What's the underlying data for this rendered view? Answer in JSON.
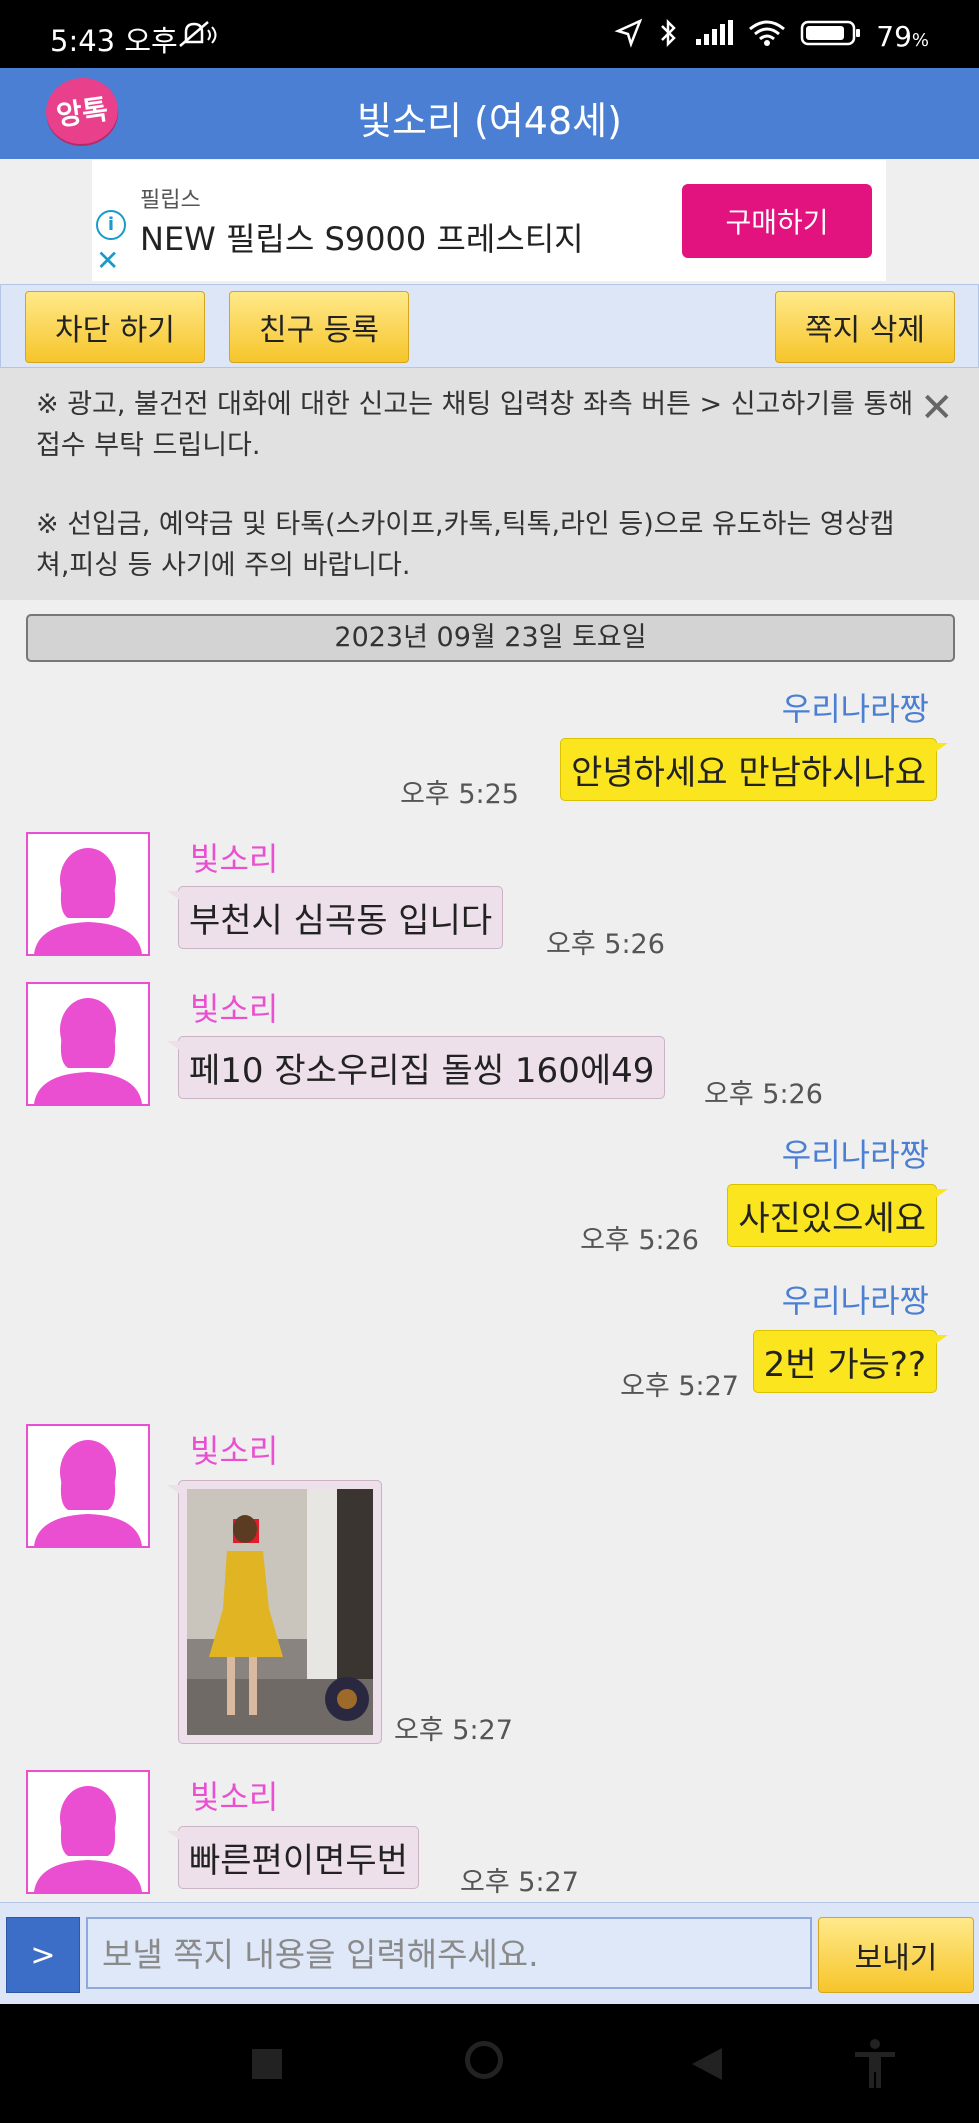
{
  "status": {
    "time": "5:43 오후",
    "battery": "79"
  },
  "header": {
    "logo": "앙톡",
    "title": "빛소리 (여48세)"
  },
  "ad": {
    "brand": "필립스",
    "product": "NEW 필립스 S9000 프레스티지",
    "buy": "구매하기"
  },
  "actions": {
    "block": "차단 하기",
    "friend": "친구 등록",
    "delete": "쪽지 삭제"
  },
  "notice": {
    "line1": "※ 광고, 불건전 대화에 대한 신고는 채팅 입력창 좌측 버튼 > 신고하기를 통해 접수 부탁 드립니다.",
    "line2": "※ 선입금, 예약금 및 타톡(스카이프,카톡,틱톡,라인 등)으로 유도하는 영상캡쳐,피싱 등 사기에 주의 바랍니다."
  },
  "date": "2023년 09월 23일 토요일",
  "messages": [
    {
      "sender": "우리나라짱",
      "text": "안녕하세요 만남하시나요",
      "time": "오후 5:25"
    },
    {
      "sender": "빛소리",
      "text": "부천시 심곡동 입니다",
      "time": "오후 5:26"
    },
    {
      "sender": "빛소리",
      "text": "페10 장소우리집 돌씽 160에49",
      "time": "오후 5:26"
    },
    {
      "sender": "우리나라짱",
      "text": "사진있으세요",
      "time": "오후 5:26"
    },
    {
      "sender": "우리나라짱",
      "text": "2번 가능??",
      "time": "오후 5:27"
    },
    {
      "sender": "빛소리",
      "text": "",
      "time": "오후 5:27"
    },
    {
      "sender": "빛소리",
      "text": "빠른편이면두번",
      "time": "오후 5:27"
    }
  ],
  "input": {
    "plus": ">",
    "placeholder": "보낼 쪽지 내용을 입력해주세요.",
    "send": "보내기"
  },
  "colors": {
    "header": "#4a7fd4",
    "me_bubble": "#fbe51e",
    "her_bubble": "#ede0ea",
    "her_name": "#ea4fd1",
    "ad_button": "#e2127f"
  }
}
